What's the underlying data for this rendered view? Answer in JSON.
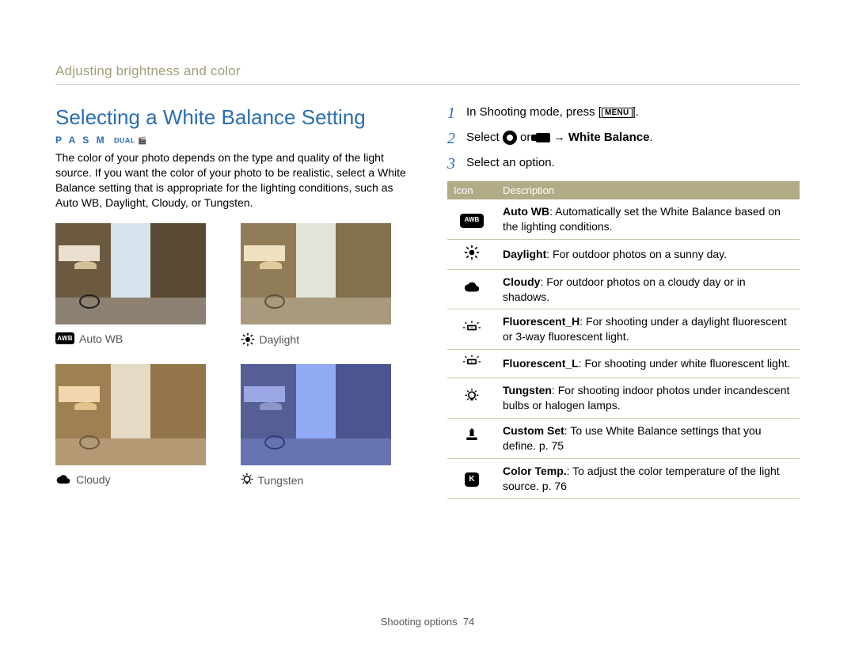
{
  "breadcrumb": "Adjusting brightness and color",
  "title": "Selecting a White Balance Setting",
  "mode_line_main": "P A S M",
  "mode_line_small": "DUAL",
  "intro": "The color of your photo depends on the type and quality of the light source. If you want the color of your photo to be realistic, select a White Balance setting that is appropriate for the lighting conditions, such as Auto WB, Daylight, Cloudy, or Tungsten.",
  "thumbs": [
    {
      "label": "Auto WB",
      "key": "auto"
    },
    {
      "label": "Daylight",
      "key": "daylight"
    },
    {
      "label": "Cloudy",
      "key": "cloudy"
    },
    {
      "label": "Tungsten",
      "key": "tungsten"
    }
  ],
  "steps": {
    "s1_a": "In Shooting mode, press [",
    "s1_menu": "MENU",
    "s1_b": "].",
    "s2_a": "Select ",
    "s2_b": " or ",
    "s2_c": " → ",
    "s2_d": "White Balance",
    "s2_e": ".",
    "s3": "Select an option."
  },
  "table": {
    "h1": "Icon",
    "h2": "Description",
    "rows": [
      {
        "icon": "awb",
        "bold": "Auto WB",
        "text": ": Automatically set the White Balance based on the lighting conditions."
      },
      {
        "icon": "daylight",
        "bold": "Daylight",
        "text": ": For outdoor photos on a sunny day."
      },
      {
        "icon": "cloudy",
        "bold": "Cloudy",
        "text": ": For outdoor photos on a cloudy day or in shadows."
      },
      {
        "icon": "fh",
        "bold": "Fluorescent_H",
        "text": ": For shooting under a daylight fluorescent or 3-way fluorescent light."
      },
      {
        "icon": "fl",
        "bold": "Fluorescent_L",
        "text": ": For shooting under white fluorescent light."
      },
      {
        "icon": "tungsten",
        "bold": "Tungsten",
        "text": ": For shooting indoor photos under incandescent bulbs or halogen lamps."
      },
      {
        "icon": "custom",
        "bold": "Custom Set",
        "text": ": To use White Balance settings that you define. p. 75"
      },
      {
        "icon": "k",
        "bold": "Color Temp.",
        "text": ": To adjust the color temperature of the light source. p. 76"
      }
    ]
  },
  "footer_label": "Shooting options",
  "footer_page": "74"
}
